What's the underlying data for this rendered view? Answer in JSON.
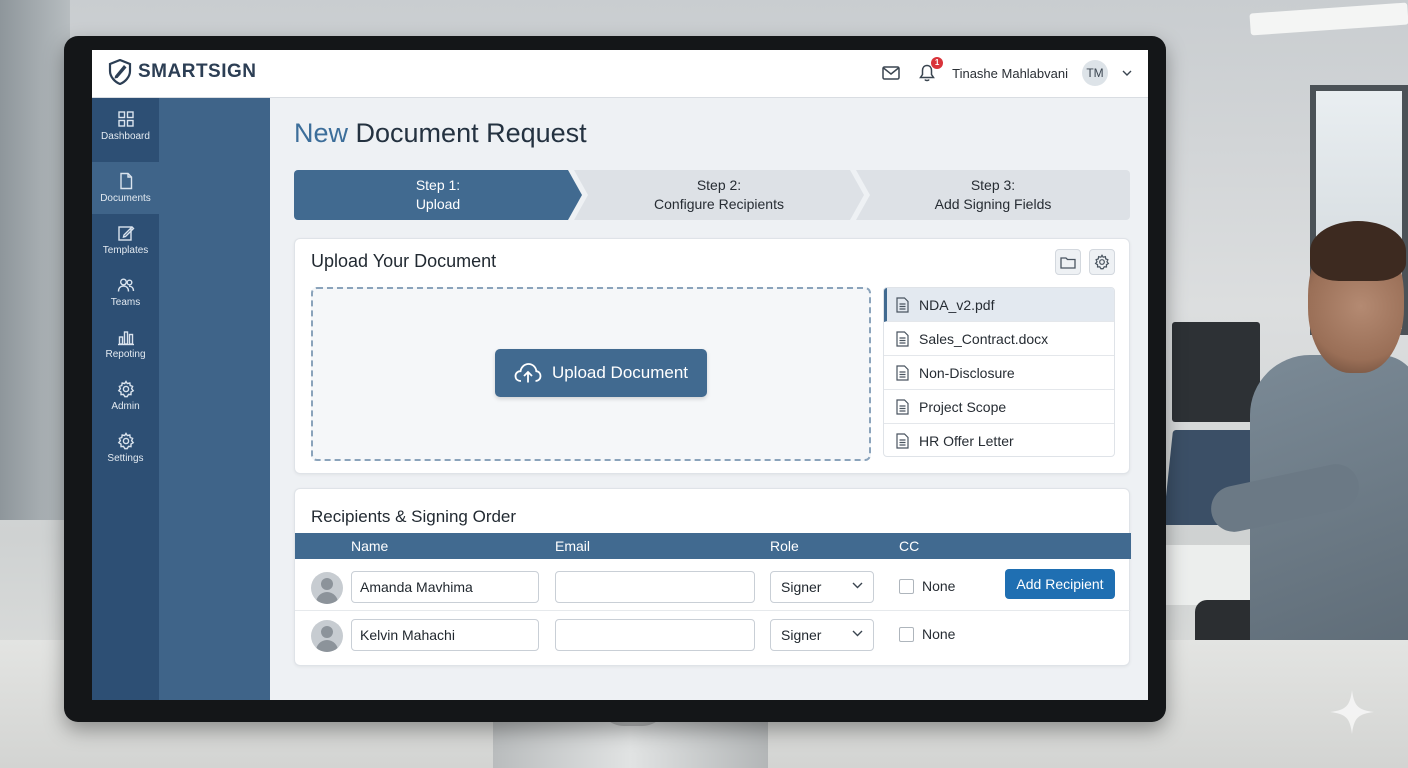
{
  "app": {
    "brand": "SMARTSIGN",
    "accent_color": "#416a90",
    "sidebar_color": "#2d4f74"
  },
  "header": {
    "mail_icon": "mail-icon",
    "notification_icon": "bell-icon",
    "notification_count": "1",
    "user_name": "Tinashe Mahlabvani",
    "user_initials": "TM"
  },
  "sidebar": {
    "items": [
      {
        "label": "Dashboard",
        "icon": "grid-icon"
      },
      {
        "label": "Documents",
        "icon": "document-icon"
      },
      {
        "label": "Templates",
        "icon": "edit-icon"
      },
      {
        "label": "Teams",
        "icon": "team-icon"
      },
      {
        "label": "Repoting",
        "icon": "chart-icon"
      },
      {
        "label": "Admin",
        "icon": "gear-icon"
      },
      {
        "label": "Settings",
        "icon": "gear-icon"
      }
    ],
    "active_index": 1
  },
  "page": {
    "title_accent": "New",
    "title_rest": "Document Request"
  },
  "stepper": {
    "steps": [
      {
        "line1": "Step 1:",
        "line2": "Upload"
      },
      {
        "line1": "Step 2:",
        "line2": "Configure Recipients"
      },
      {
        "line1": "Step 3:",
        "line2": "Add Signing Fields"
      }
    ],
    "active_step": 1
  },
  "upload": {
    "title": "Upload Your Document",
    "button_label": "Upload Document",
    "files": [
      "NDA_v2.pdf",
      "Sales_Contract.docx",
      "Non-Disclosure",
      "Project Scope",
      "HR Offer Letter"
    ],
    "selected_file_index": 0
  },
  "recipients": {
    "title": "Recipients & Signing Order",
    "columns": {
      "name": "Name",
      "email": "Email",
      "role": "Role",
      "cc": "CC"
    },
    "rows": [
      {
        "name": "Amanda Mavhima",
        "email": "",
        "role": "Signer",
        "cc": "None"
      },
      {
        "name": "Kelvin Mahachi",
        "email": "",
        "role": "Signer",
        "cc": "None"
      }
    ],
    "add_button": "Add Recipient"
  }
}
